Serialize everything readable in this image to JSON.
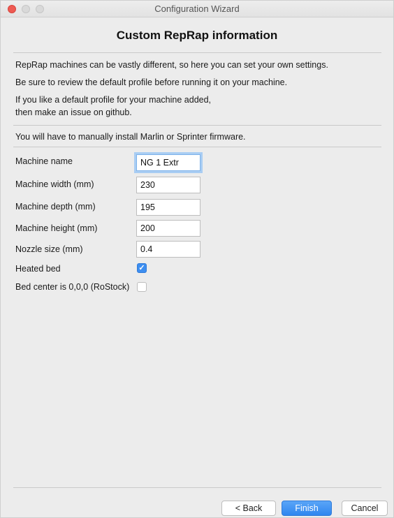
{
  "window": {
    "title": "Configuration Wizard",
    "controls": [
      "close",
      "minimize",
      "zoom"
    ]
  },
  "page": {
    "title": "Custom RepRap information"
  },
  "info": {
    "line1": "RepRap machines can be vastly different, so here you can set your own settings.",
    "line2": "Be sure to review the default profile before running it on your machine.",
    "line3": "If you like a default profile for your machine added,",
    "line4": "then make an issue on github.",
    "line5": "You will have to manually install Marlin or Sprinter firmware."
  },
  "form": {
    "machine_name": {
      "label": "Machine name",
      "value": "NG 1 Extr"
    },
    "machine_width": {
      "label": "Machine width (mm)",
      "value": "230"
    },
    "machine_depth": {
      "label": "Machine depth (mm)",
      "value": "195"
    },
    "machine_height": {
      "label": "Machine height (mm)",
      "value": "200"
    },
    "nozzle_size": {
      "label": "Nozzle size (mm)",
      "value": "0.4"
    },
    "heated_bed": {
      "label": "Heated bed",
      "checked": true
    },
    "bed_center": {
      "label": "Bed center is 0,0,0 (RoStock)",
      "checked": false
    }
  },
  "buttons": {
    "back": "< Back",
    "finish": "Finish",
    "cancel": "Cancel"
  },
  "colors": {
    "accent": "#3d8ef0",
    "close": "#ee5a52"
  }
}
